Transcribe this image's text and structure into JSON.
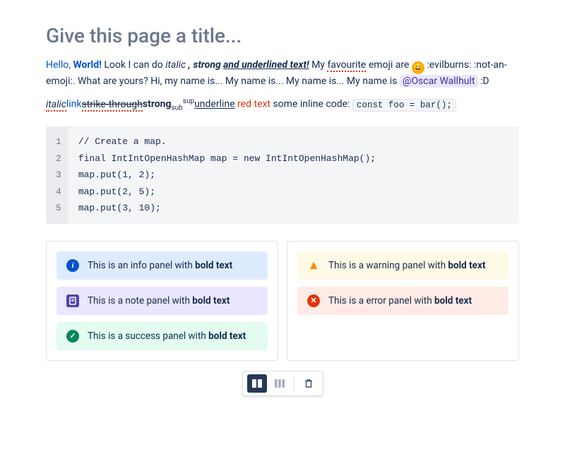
{
  "title_placeholder": "Give this page a title...",
  "para1": {
    "hello": "Hello,",
    "world": "World!",
    "look": " Look I can do ",
    "italic": "italic ",
    "strong": ", strong ",
    "underlined": "and underlined text!",
    "my": " My ",
    "favourite": "favourite",
    "emoji_are": " emoji are ",
    "after_emoji": " :evilburns: :not-an-emoji:. What are yours?  Hi, my name is... My name is... My name is... My name is ",
    "mention": "@Oscar Wallhult",
    "end": "  :D"
  },
  "para2": {
    "italic": "italic",
    "link": "link",
    "strike": "strike-through",
    "strong": "strong",
    "sub": "sub",
    "sup": "sup",
    "uline": "underline",
    "red": " red text ",
    "inline_label": "some inline code: ",
    "inline_code": "const foo = bar();"
  },
  "code": {
    "lines": [
      "// Create a map.",
      "final IntIntOpenHashMap map = new IntIntOpenHashMap();",
      "map.put(1, 2);",
      "map.put(2, 5);",
      "map.put(3, 10);"
    ]
  },
  "panels": {
    "info": {
      "pre": "This is an info panel with ",
      "bold": "bold text"
    },
    "note": {
      "pre": "This is a note panel with ",
      "bold": "bold text"
    },
    "success": {
      "pre": "This is a success panel with ",
      "bold": "bold text"
    },
    "warning": {
      "pre": "This is a warning panel with ",
      "bold": "bold text"
    },
    "error": {
      "pre": "This is a error panel with ",
      "bold": "bold text"
    }
  }
}
